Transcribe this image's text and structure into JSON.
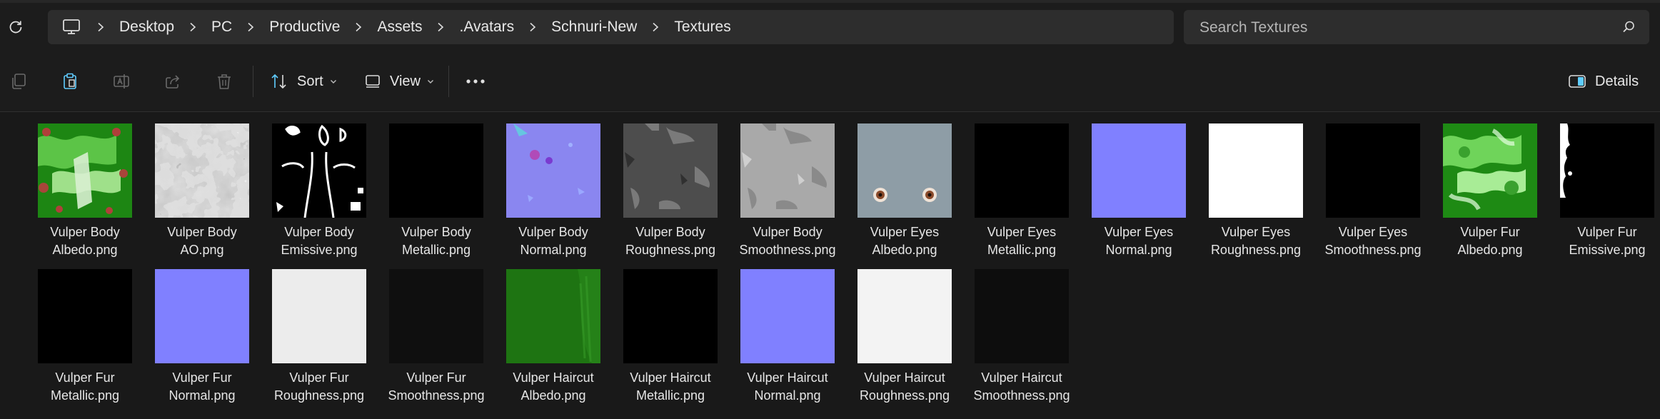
{
  "breadcrumb": [
    "Desktop",
    "PC",
    "Productive",
    "Assets",
    ".Avatars",
    "Schnuri-New",
    "Textures"
  ],
  "search": {
    "placeholder": "Search Textures"
  },
  "toolbar": {
    "sort_label": "Sort",
    "view_label": "View",
    "details_label": "Details"
  },
  "colors": {
    "accent": "#60cdff",
    "background": "#191919",
    "bar": "#2d2d2d"
  },
  "files": [
    {
      "line1": "Vulper Body",
      "line2": "Albedo.png",
      "thumb": "camo-green-red"
    },
    {
      "line1": "Vulper Body",
      "line2": "AO.png",
      "thumb": "grey-white-mottled"
    },
    {
      "line1": "Vulper Body",
      "line2": "Emissive.png",
      "thumb": "black-white-face"
    },
    {
      "line1": "Vulper Body",
      "line2": "Metallic.png",
      "thumb": "black"
    },
    {
      "line1": "Vulper Body",
      "line2": "Normal.png",
      "thumb": "normal-map-blue"
    },
    {
      "line1": "Vulper Body",
      "line2": "Roughness.png",
      "thumb": "dark-grey-mottled"
    },
    {
      "line1": "Vulper Body",
      "line2": "Smoothness.png",
      "thumb": "light-grey-mottled"
    },
    {
      "line1": "Vulper Eyes",
      "line2": "Albedo.png",
      "thumb": "grey-eyes"
    },
    {
      "line1": "Vulper Eyes",
      "line2": "Metallic.png",
      "thumb": "black"
    },
    {
      "line1": "Vulper Eyes",
      "line2": "Normal.png",
      "thumb": "flat-normal"
    },
    {
      "line1": "Vulper Eyes",
      "line2": "Roughness.png",
      "thumb": "white"
    },
    {
      "line1": "Vulper Eyes",
      "line2": "Smoothness.png",
      "thumb": "black"
    },
    {
      "line1": "Vulper Fur",
      "line2": "Albedo.png",
      "thumb": "camo-green"
    },
    {
      "line1": "Vulper Fur",
      "line2": "Emissive.png",
      "thumb": "black-white-edge"
    },
    {
      "line1": "Vulper Fur",
      "line2": "Metallic.png",
      "thumb": "black"
    },
    {
      "line1": "Vulper Fur",
      "line2": "Normal.png",
      "thumb": "flat-normal"
    },
    {
      "line1": "Vulper Fur",
      "line2": "Roughness.png",
      "thumb": "near-white"
    },
    {
      "line1": "Vulper Fur",
      "line2": "Smoothness.png",
      "thumb": "near-black"
    },
    {
      "line1": "Vulper Haircut",
      "line2": "Albedo.png",
      "thumb": "green"
    },
    {
      "line1": "Vulper Haircut",
      "line2": "Metallic.png",
      "thumb": "black"
    },
    {
      "line1": "Vulper Haircut",
      "line2": "Normal.png",
      "thumb": "flat-normal"
    },
    {
      "line1": "Vulper Haircut",
      "line2": "Roughness.png",
      "thumb": "near-white2"
    },
    {
      "line1": "Vulper Haircut",
      "line2": "Smoothness.png",
      "thumb": "near-black2"
    }
  ]
}
